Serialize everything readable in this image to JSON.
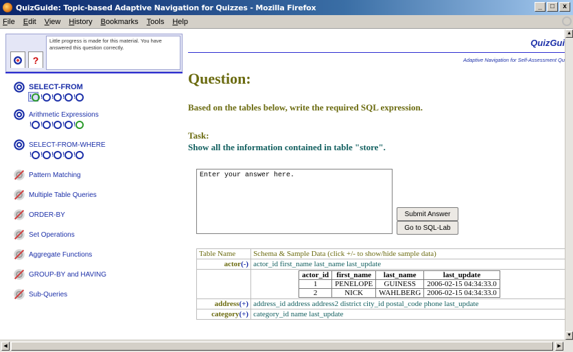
{
  "window": {
    "title": "QuizGuide: Topic-based Adaptive Navigation for Quizzes - Mozilla Firefox",
    "minimize": "_",
    "maximize": "□",
    "close": "x"
  },
  "menu": [
    "File",
    "Edit",
    "View",
    "History",
    "Bookmarks",
    "Tools",
    "Help"
  ],
  "left": {
    "tabs": {
      "help": "?"
    },
    "tooltip": "Little progress is made for this material. You have answered this question correctly.",
    "topics": [
      {
        "label": "SELECT-FROM",
        "state": "current",
        "questions": 5
      },
      {
        "label": "Arithmetic Expressions",
        "state": "open",
        "questions": 5
      },
      {
        "label": "SELECT-FROM-WHERE",
        "state": "open",
        "questions": 5
      },
      {
        "label": "Pattern Matching",
        "state": "blocked"
      },
      {
        "label": "Multiple Table Queries",
        "state": "blocked"
      },
      {
        "label": "ORDER-BY",
        "state": "blocked"
      },
      {
        "label": "Set Operations",
        "state": "blocked"
      },
      {
        "label": "Aggregate Functions",
        "state": "blocked"
      },
      {
        "label": "GROUP-BY and HAVING",
        "state": "blocked"
      },
      {
        "label": "Sub-Queries",
        "state": "blocked"
      }
    ]
  },
  "right": {
    "brand": "QuizGui",
    "brand_sub": "Adaptive Navigation for Self-Assessment Qu",
    "heading": "Question:",
    "instruction": "Based on the tables below, write the required SQL expression.",
    "task_label": "Task:",
    "task_text": "Show all the information contained in table \"store\".",
    "answer_text": "Enter your answer here.",
    "submit_label": "Submit Answer",
    "sqllab_label": "Go to SQL-Lab",
    "schema_table": {
      "headers": [
        "Table Name",
        "Schema & Sample Data (click +/- to show/hide sample data)"
      ],
      "rows": [
        {
          "name": "actor",
          "toggle": "(-)",
          "columns": "actor_id first_name last_name last_update"
        },
        {
          "name": "address",
          "toggle": "(+)",
          "columns": "address_id address address2 district city_id postal_code phone last_update"
        },
        {
          "name": "category",
          "toggle": "(+)",
          "columns": "category_id name last_update"
        }
      ],
      "sample": {
        "headers": [
          "actor_id",
          "first_name",
          "last_name",
          "last_update"
        ],
        "rows": [
          [
            "1",
            "PENELOPE",
            "GUINESS",
            "2006-02-15 04:34:33.0"
          ],
          [
            "2",
            "NICK",
            "WAHLBERG",
            "2006-02-15 04:34:33.0"
          ]
        ]
      }
    }
  }
}
